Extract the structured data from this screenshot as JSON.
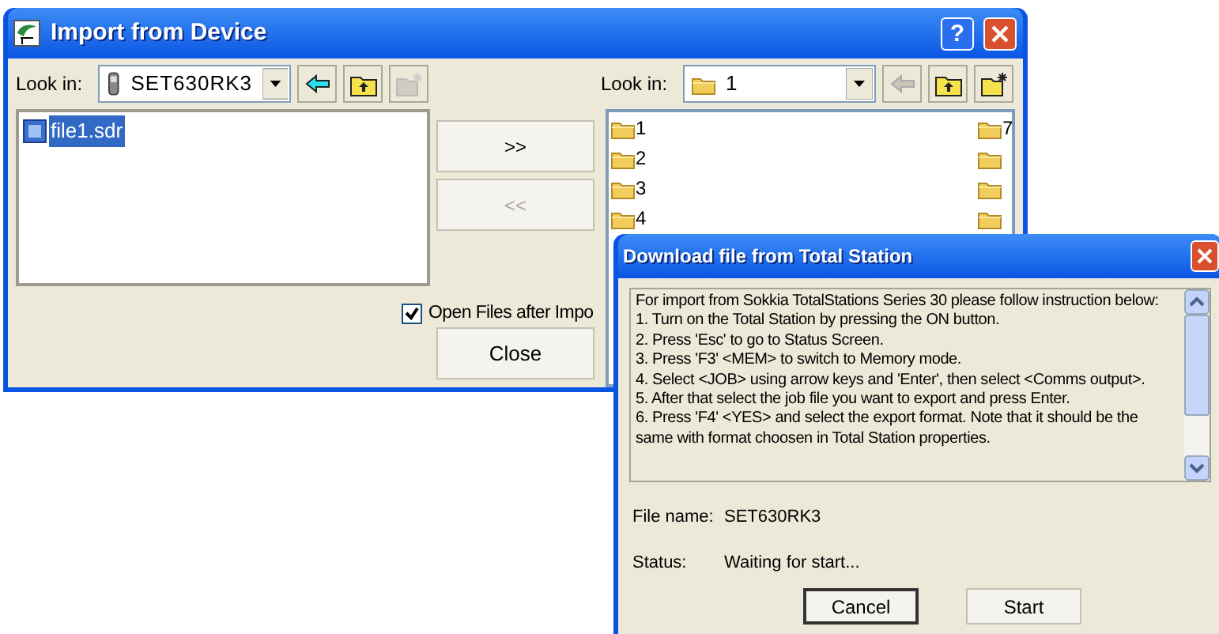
{
  "import_window": {
    "title": "Import from Device",
    "help_button": "?",
    "left_pane": {
      "look_in_label": "Look in:",
      "location": "SET630RK3",
      "back_disabled": false,
      "new_folder_disabled": true,
      "files": [
        {
          "label": "file1.sdr",
          "selected": true
        }
      ]
    },
    "transfer_buttons": [
      {
        "label": ">>",
        "disabled": false
      },
      {
        "label": "<<",
        "disabled": true
      }
    ],
    "right_pane": {
      "look_in_label": "Look in:",
      "location": "1",
      "back_disabled": true,
      "new_folder_disabled": false,
      "folders_column_1": [
        {
          "kind": "labeled",
          "label": "1"
        },
        {
          "kind": "labeled",
          "label": "2"
        },
        {
          "kind": "labeled",
          "label": "3"
        },
        {
          "kind": "labeled",
          "label": "4"
        }
      ],
      "folders_column_2": [
        {
          "kind": "labeled",
          "label": "7"
        },
        {
          "kind": "cut_off"
        },
        {
          "kind": "cut_off"
        },
        {
          "kind": "cut_off"
        }
      ]
    },
    "open_files_checkbox": {
      "label": "Open Files after Impo",
      "checked": true
    },
    "close_button": "Close"
  },
  "download_dialog": {
    "title": "Download file from Total Station",
    "instructions": [
      "For import from Sokkia TotalStations Series 30 please follow instruction below:",
      "1. Turn on the Total Station by pressing the ON button.",
      "2. Press 'Esc' to go to Status Screen.",
      "3. Press 'F3' <MEM> to switch to Memory mode.",
      "4. Select <JOB> using arrow keys and 'Enter', then select <Comms output>.",
      "5. After that select the job file you want to export and press Enter.",
      "6. Press 'F4' <YES> and select the export format. Note that it should be the same with format choosen in Total Station properties."
    ],
    "fields": [
      {
        "label": "File name:",
        "value": "SET630RK3"
      },
      {
        "label": "Status:",
        "value": "Waiting for start..."
      }
    ],
    "buttons": [
      {
        "label": "Cancel",
        "focused": true
      },
      {
        "label": "Start",
        "focused": false
      }
    ]
  }
}
